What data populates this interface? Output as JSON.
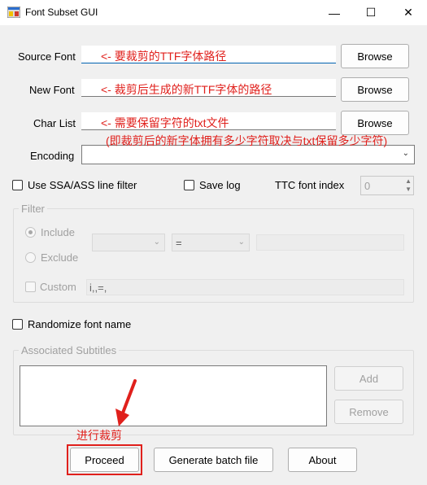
{
  "window": {
    "title": "Font Subset GUI",
    "minimize": "—",
    "maximize": "☐",
    "close": "✕"
  },
  "source_font": {
    "label": "Source Font",
    "note": "<- 要裁剪的TTF字体路径",
    "browse": "Browse"
  },
  "new_font": {
    "label": "New Font",
    "note": "<- 裁剪后生成的新TTF字体的路径",
    "browse": "Browse"
  },
  "char_list": {
    "label": "Char List",
    "note": "<- 需要保留字符的txt文件",
    "note2": "(即裁剪后的新字体拥有多少字符取决与txt保留多少字符)",
    "browse": "Browse"
  },
  "encoding": {
    "label": "Encoding",
    "value": ""
  },
  "options": {
    "ssa_filter": "Use SSA/ASS line filter",
    "save_log": "Save log",
    "ttc_label": "TTC font index",
    "ttc_value": "0"
  },
  "filter": {
    "title": "Filter",
    "include": "Include",
    "exclude": "Exclude",
    "custom": "Custom",
    "operator": "=",
    "custom_value": "i,,=,"
  },
  "randomize": "Randomize font name",
  "subtitles": {
    "title": "Associated Subtitles",
    "add": "Add",
    "remove": "Remove"
  },
  "annotation": {
    "text": "进行裁剪"
  },
  "footer": {
    "proceed": "Proceed",
    "batch": "Generate batch file",
    "about": "About"
  },
  "colors": {
    "annotation_red": "#e0201c",
    "underline_blue": "#0063b1"
  }
}
